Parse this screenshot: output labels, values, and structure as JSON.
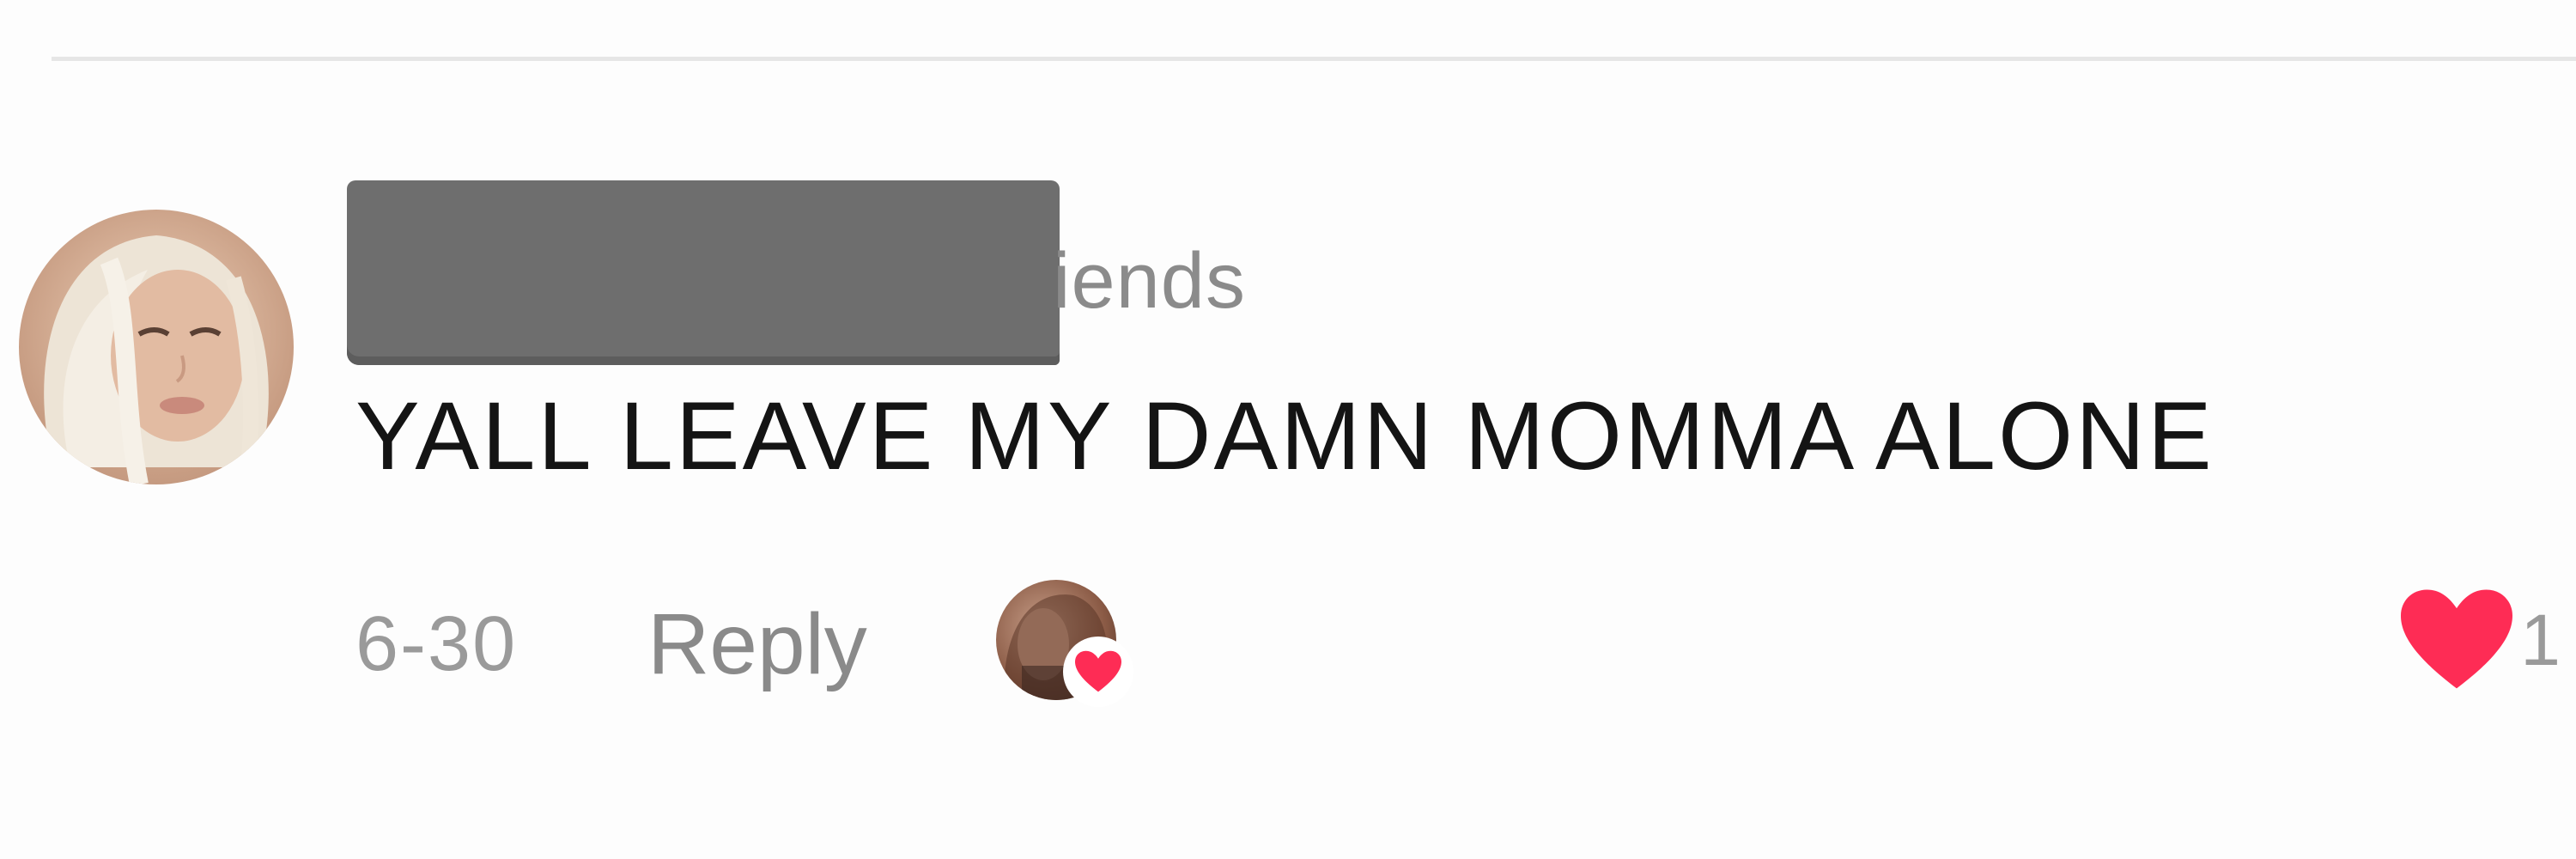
{
  "comment": {
    "username_visible_suffix": "iends",
    "text": "YALL LEAVE MY DAMN MOMMA ALONE",
    "timestamp": "6-30",
    "reply_label": "Reply",
    "like_count": "1",
    "liked_by_creator": true
  },
  "colors": {
    "like_heart": "#fe2c55",
    "redaction_box": "#6e6e6e",
    "secondary_text": "#8a8a8a",
    "primary_text": "#141414"
  },
  "icons": {
    "avatar": "user-avatar",
    "creator_liked": "creator-liked-heart-icon",
    "like": "heart-icon"
  }
}
